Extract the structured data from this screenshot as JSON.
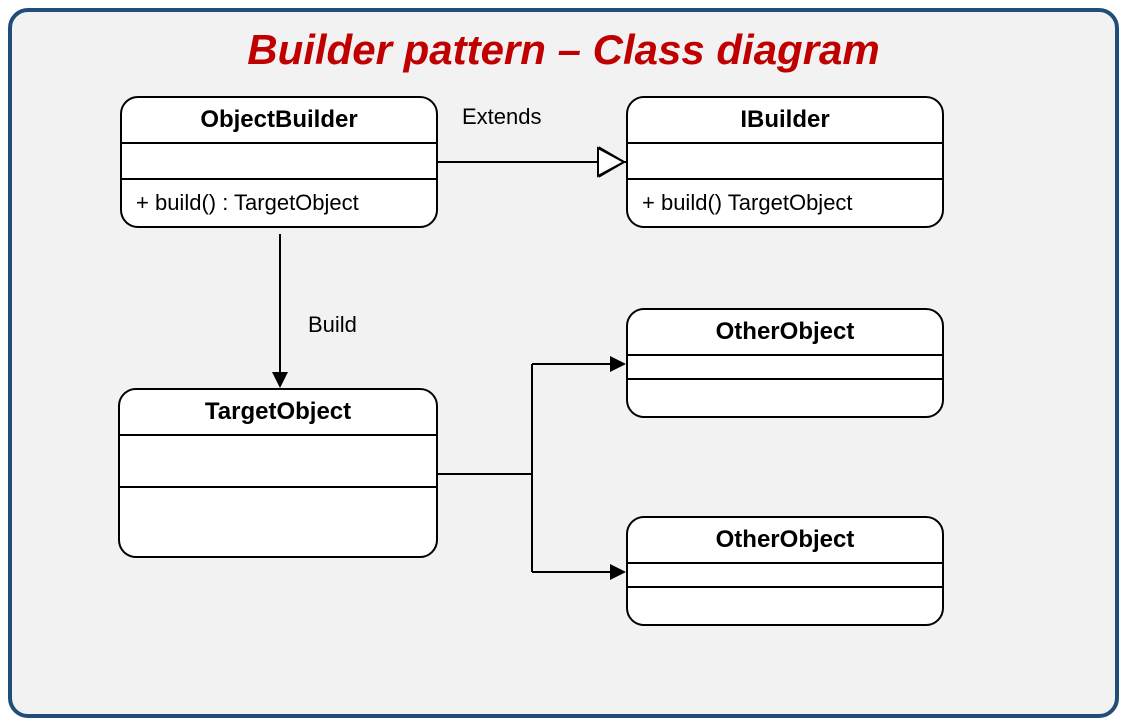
{
  "title": "Builder pattern – Class diagram",
  "classes": {
    "objectBuilder": {
      "name": "ObjectBuilder",
      "ops": "+ build() : TargetObject"
    },
    "iBuilder": {
      "name": "IBuilder",
      "ops": "+ build() TargetObject"
    },
    "targetObject": {
      "name": "TargetObject"
    },
    "otherObject1": {
      "name": "OtherObject"
    },
    "otherObject2": {
      "name": "OtherObject"
    }
  },
  "edges": {
    "extends": "Extends",
    "build": "Build"
  }
}
